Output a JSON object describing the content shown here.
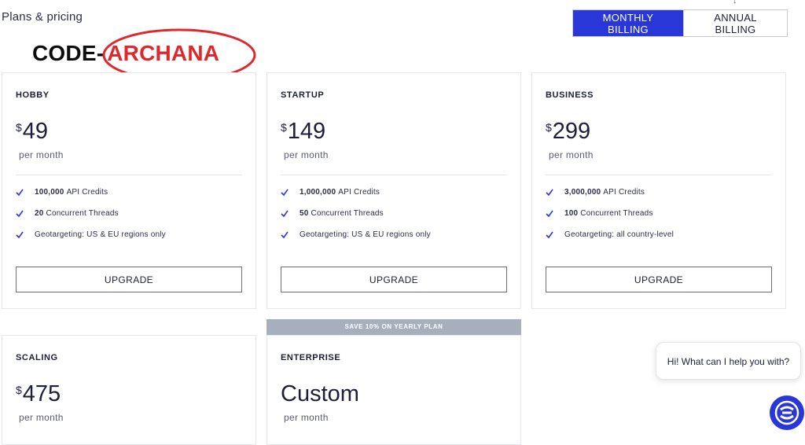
{
  "header": {
    "title": "Plans & pricing"
  },
  "billing": {
    "monthly_label": "MONTHLY BILLING",
    "annual_label": "ANNUAL BILLING",
    "selected": "monthly"
  },
  "promo": {
    "prefix": "CODE-",
    "code": "ARCHANA"
  },
  "plans": [
    {
      "name": "HOBBY",
      "currency": "$",
      "price": "49",
      "period": "per month",
      "features": [
        {
          "bold": "100,000",
          "text": "API Credits"
        },
        {
          "bold": "20",
          "text": "Concurrent Threads"
        },
        {
          "bold": "",
          "text": "Geotargeting: US & EU regions only"
        }
      ],
      "button": "UPGRADE"
    },
    {
      "name": "STARTUP",
      "currency": "$",
      "price": "149",
      "period": "per month",
      "features": [
        {
          "bold": "1,000,000",
          "text": "API Credits"
        },
        {
          "bold": "50",
          "text": "Concurrent Threads"
        },
        {
          "bold": "",
          "text": "Geotargeting: US & EU regions only"
        }
      ],
      "button": "UPGRADE"
    },
    {
      "name": "BUSINESS",
      "currency": "$",
      "price": "299",
      "period": "per month",
      "features": [
        {
          "bold": "3,000,000",
          "text": "API Credits"
        },
        {
          "bold": "100",
          "text": "Concurrent Threads"
        },
        {
          "bold": "",
          "text": "Geotargeting: all country-level"
        }
      ],
      "button": "UPGRADE"
    },
    {
      "name": "SCALING",
      "currency": "$",
      "price": "475",
      "period": "per month"
    },
    {
      "name": "ENTERPRISE",
      "currency": "",
      "price": "Custom",
      "period": "per month",
      "banner": "SAVE 10% ON YEARLY PLAN"
    }
  ],
  "chat": {
    "greeting": "Hi! What can I help you with?"
  },
  "colors": {
    "accent": "#2a37d8",
    "annotation": "#e0282c",
    "banner": "#a6b0bd"
  },
  "icons": {
    "check": "check-icon",
    "chat": "chat-launcher-icon",
    "arrow": "annotation-arrow-icon"
  }
}
